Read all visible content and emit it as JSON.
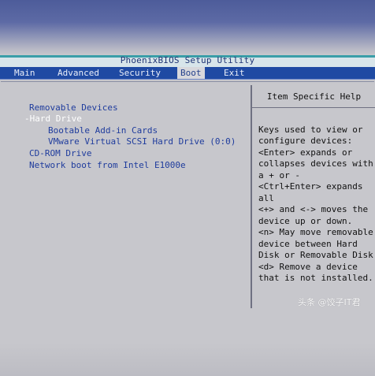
{
  "header": {
    "title": "PhoenixBIOS Setup Utility"
  },
  "tabs": [
    {
      "label": "Main"
    },
    {
      "label": "Advanced"
    },
    {
      "label": "Security"
    },
    {
      "label": "Boot"
    },
    {
      "label": "Exit"
    }
  ],
  "boot_menu": {
    "items": [
      {
        "label": "Removable Devices"
      },
      {
        "label": "-Hard Drive"
      },
      {
        "label": "Bootable Add-in Cards"
      },
      {
        "label": "VMware Virtual SCSI Hard Drive (0:0)"
      },
      {
        "label": "CD-ROM Drive"
      },
      {
        "label": "Network boot from Intel E1000e"
      }
    ]
  },
  "help_panel": {
    "title": "Item Specific Help",
    "lines": [
      "Keys used to view or",
      "configure devices:",
      "<Enter> expands or",
      "collapses devices with",
      "a + or -",
      "<Ctrl+Enter> expands",
      "all",
      "<+> and <-> moves the",
      "device up or down.",
      "<n> May move removable",
      "device between Hard",
      "Disk or Removable Disk",
      "<d> Remove a device",
      "that is not installed."
    ]
  },
  "watermark": {
    "text": "头条 @饺子IT君"
  },
  "colors": {
    "menubar": "#1f4aa3",
    "selected_tab_text": "#24418c",
    "menu_item": "#1f3c9d",
    "selected_item": "#ffffff",
    "panel_bg": "#c7c7cc"
  }
}
